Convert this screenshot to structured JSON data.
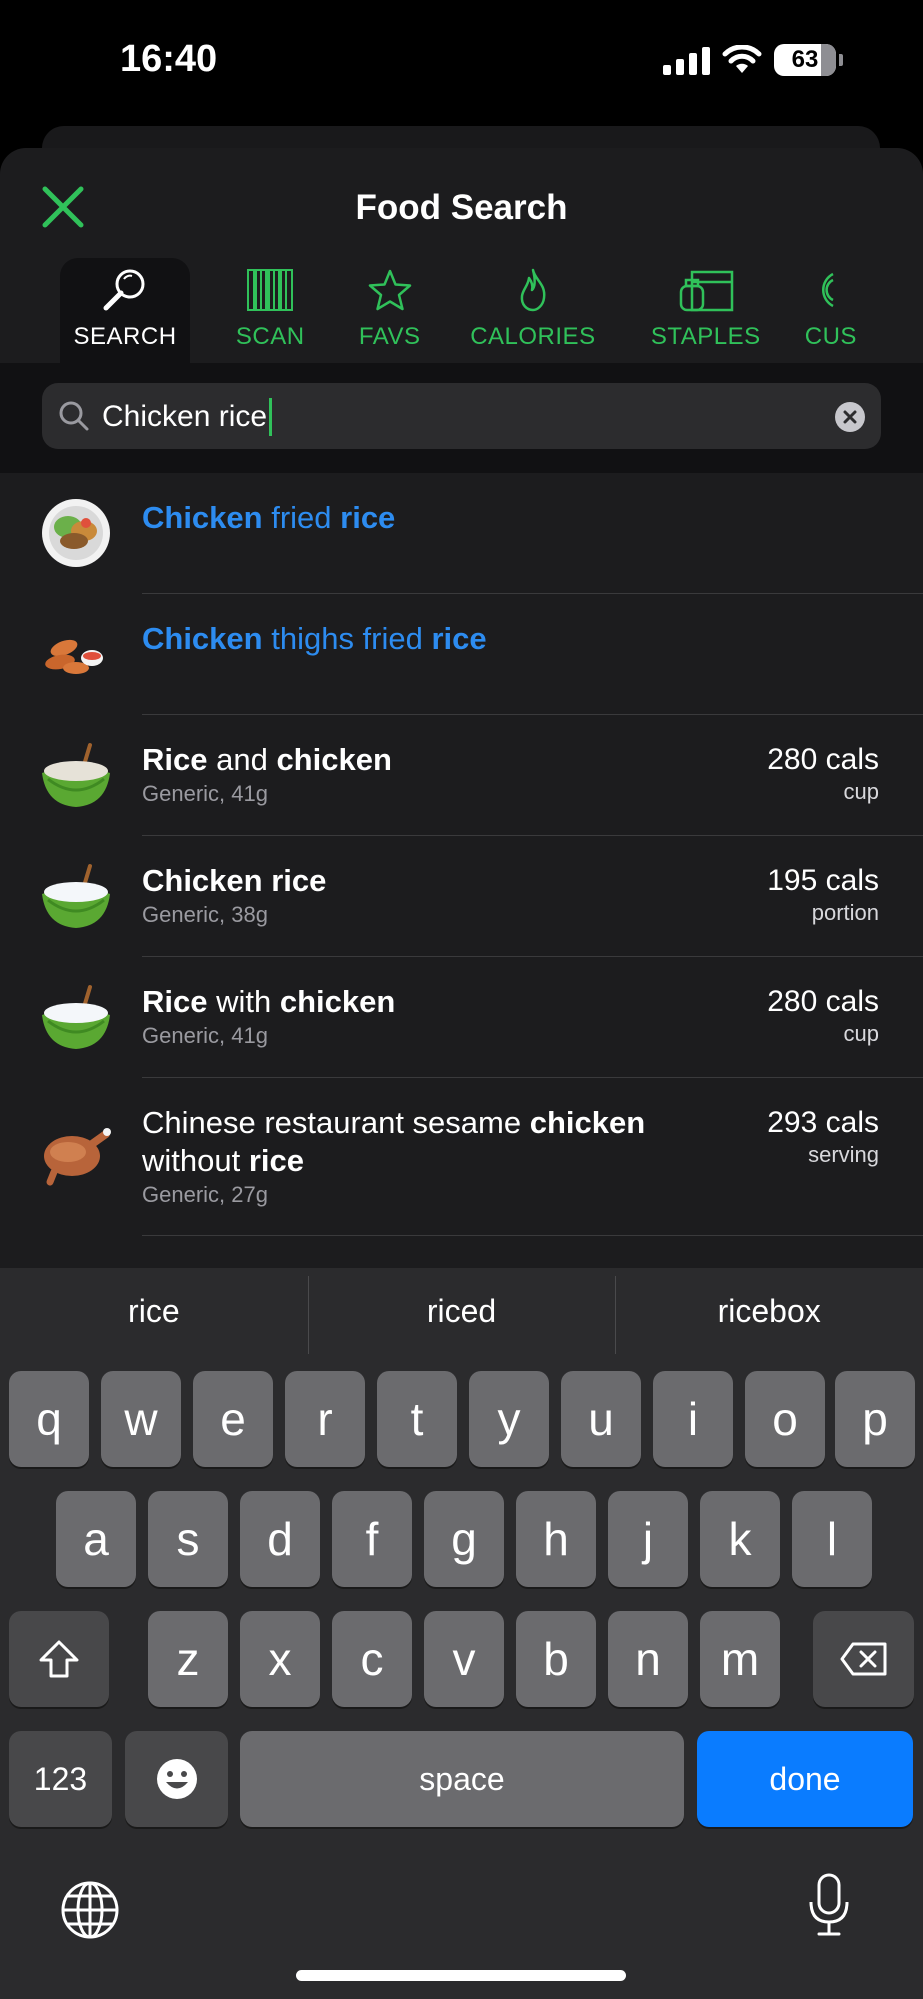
{
  "status": {
    "time": "16:40",
    "battery": "63"
  },
  "header": {
    "title": "Food Search"
  },
  "tabs": [
    {
      "label": "SEARCH",
      "icon": "search-icon",
      "active": true
    },
    {
      "label": "SCAN",
      "icon": "barcode-icon",
      "active": false
    },
    {
      "label": "FAVS",
      "icon": "star-icon",
      "active": false
    },
    {
      "label": "CALORIES",
      "icon": "flame-icon",
      "active": false
    },
    {
      "label": "STAPLES",
      "icon": "pantry-icon",
      "active": false
    },
    {
      "label": "CUS",
      "icon": "custom-icon",
      "active": false
    }
  ],
  "search": {
    "query": "Chicken rice"
  },
  "results": [
    {
      "name_parts": [
        "Chicken",
        " fried ",
        "rice"
      ],
      "subtitle": "",
      "cals": "",
      "unit": "",
      "icon": "salad-plate-icon",
      "style": "link"
    },
    {
      "name_parts": [
        "Chicken",
        " thighs fried ",
        "rice"
      ],
      "subtitle": "",
      "cals": "",
      "unit": "",
      "icon": "nuggets-icon",
      "style": "link"
    },
    {
      "name_parts": [
        "Rice",
        " and ",
        "chicken"
      ],
      "subtitle": "Generic, 41g",
      "cals": "280 cals",
      "unit": "cup",
      "icon": "rice-bowl-icon",
      "style": "plain"
    },
    {
      "name_parts": [
        "Chicken rice"
      ],
      "subtitle": "Generic, 38g",
      "cals": "195 cals",
      "unit": "portion",
      "icon": "rice-bowl-icon",
      "style": "plain"
    },
    {
      "name_parts": [
        "Rice",
        " with ",
        "chicken"
      ],
      "subtitle": "Generic, 41g",
      "cals": "280 cals",
      "unit": "cup",
      "icon": "rice-bowl-icon",
      "style": "plain"
    },
    {
      "name_parts": [
        "Chinese restaurant sesame ",
        "chicken",
        " without ",
        "rice"
      ],
      "subtitle": "Generic, 27g",
      "cals": "293 cals",
      "unit": "serving",
      "icon": "roast-chicken-icon",
      "style": "plain"
    }
  ],
  "keyboard": {
    "suggestions": [
      "rice",
      "riced",
      "ricebox"
    ],
    "row1": [
      "q",
      "w",
      "e",
      "r",
      "t",
      "y",
      "u",
      "i",
      "o",
      "p"
    ],
    "row2": [
      "a",
      "s",
      "d",
      "f",
      "g",
      "h",
      "j",
      "k",
      "l"
    ],
    "row3": [
      "z",
      "x",
      "c",
      "v",
      "b",
      "n",
      "m"
    ],
    "numbers_label": "123",
    "space_label": "space",
    "done_label": "done"
  },
  "colors": {
    "accent_green": "#30c15a",
    "link_blue": "#2d8cf0",
    "done_blue": "#0a7cff"
  }
}
